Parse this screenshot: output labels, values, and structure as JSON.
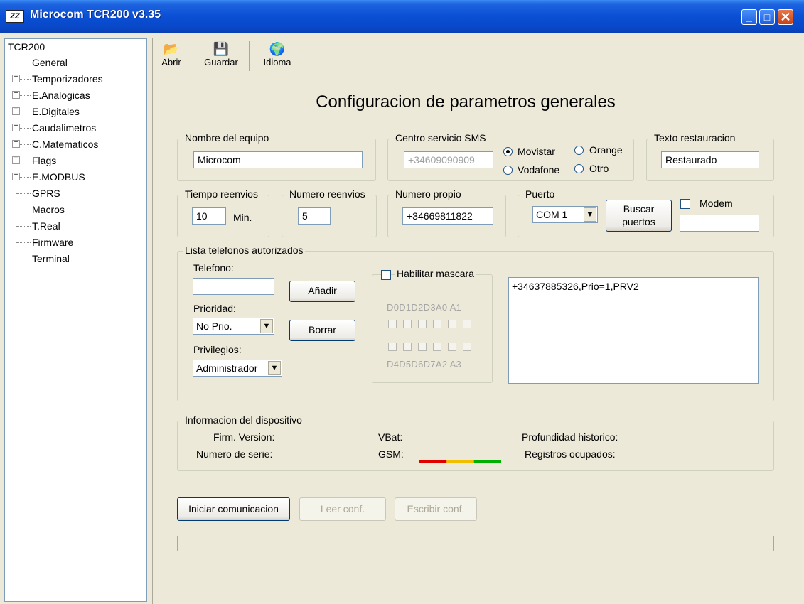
{
  "window": {
    "title": "Microcom TCR200 v3.35",
    "icon_text": "ZZ",
    "min": "_",
    "max": "□",
    "close": "✕"
  },
  "tree": {
    "root": "TCR200",
    "items": [
      {
        "label": "General",
        "expandable": false
      },
      {
        "label": "Temporizadores",
        "expandable": true
      },
      {
        "label": "E.Analogicas",
        "expandable": true
      },
      {
        "label": "E.Digitales",
        "expandable": true
      },
      {
        "label": "Caudalimetros",
        "expandable": true
      },
      {
        "label": "C.Matematicos",
        "expandable": true
      },
      {
        "label": "Flags",
        "expandable": true
      },
      {
        "label": "E.MODBUS",
        "expandable": true
      },
      {
        "label": "GPRS",
        "expandable": false
      },
      {
        "label": "Macros",
        "expandable": false
      },
      {
        "label": "T.Real",
        "expandable": false
      },
      {
        "label": "Firmware",
        "expandable": false
      },
      {
        "label": "Terminal",
        "expandable": false
      }
    ]
  },
  "toolbar": {
    "open": "Abrir",
    "save": "Guardar",
    "language": "Idioma",
    "open_icon": "open-folder-icon",
    "save_icon": "floppy-disk-icon",
    "language_icon": "globe-icon"
  },
  "page": {
    "title": "Configuracion de parametros generales"
  },
  "device_name": {
    "label": "Nombre del equipo",
    "value": "Microcom"
  },
  "sms": {
    "label": "Centro servicio SMS",
    "value": "+34609090909",
    "options": [
      "Movistar",
      "Orange",
      "Vodafone",
      "Otro"
    ],
    "selected": "Movistar"
  },
  "restore": {
    "label": "Texto restauracion",
    "value": "Restaurado"
  },
  "resend_time": {
    "label": "Tiempo reenvios",
    "value": "10",
    "unit": "Min."
  },
  "resend_count": {
    "label": "Numero reenvios",
    "value": "5"
  },
  "own_number": {
    "label": "Numero propio",
    "value": "+34669811822"
  },
  "port": {
    "label": "Puerto",
    "value": "COM 1",
    "search_button": [
      "Buscar",
      "puertos"
    ],
    "modem_label": "Modem",
    "modem_checked": false,
    "modem_value": ""
  },
  "phones": {
    "group_label": "Lista telefonos autorizados",
    "phone_label": "Telefono:",
    "phone_value": "",
    "add_button": "Añadir",
    "priority_label": "Prioridad:",
    "priority_value": "No Prio.",
    "delete_button": "Borrar",
    "privileges_label": "Privilegios:",
    "privileges_value": "Administrador",
    "mask_label": "Habilitar mascara",
    "mask_top_labels": "D0D1D2D3A0 A1",
    "mask_bottom_labels": "D4D5D6D7A2 A3",
    "list": [
      "+34637885326,Prio=1,PRV2"
    ]
  },
  "device_info": {
    "group_label": "Informacion del dispositivo",
    "firmware_label": "Firm. Version:",
    "serial_label": "Numero de serie:",
    "vbat_label": "VBat:",
    "gsm_label": "GSM:",
    "history_label": "Profundidad historico:",
    "records_label": "Registros ocupados:",
    "gsm_colors": [
      "#e00000",
      "#f0c000",
      "#00b000"
    ]
  },
  "actions": {
    "start": "Iniciar comunicacion",
    "read": "Leer conf.",
    "write": "Escribir conf."
  },
  "progress": {
    "value": 0
  }
}
